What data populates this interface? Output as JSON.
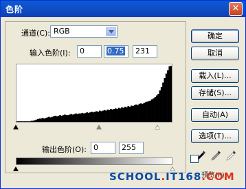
{
  "window": {
    "title": "色阶",
    "close_glyph": "✕"
  },
  "channel": {
    "label": "通道(C):",
    "value": "RGB"
  },
  "input_levels": {
    "label": "输入色阶(I):",
    "black": "0",
    "gamma": "0.75",
    "white": "231"
  },
  "output_levels": {
    "label": "输出色阶(O):",
    "black": "0",
    "white": "255"
  },
  "histogram": {
    "fill": "#000000",
    "values": [
      1,
      1,
      1,
      1,
      1,
      1,
      1,
      1,
      1,
      2,
      2,
      3,
      4,
      5,
      6,
      6,
      7,
      6,
      7,
      8,
      9,
      8,
      9,
      10,
      11,
      10,
      11,
      12,
      11,
      12,
      13,
      12,
      12,
      13,
      14,
      13,
      14,
      15,
      14,
      15,
      15,
      16,
      15,
      16,
      17,
      16,
      17,
      18,
      17,
      18,
      19,
      18,
      20,
      19,
      20,
      21,
      20,
      22,
      21,
      23,
      22,
      23,
      24,
      23,
      25,
      24,
      26,
      25,
      27,
      26,
      28,
      27,
      29,
      28,
      30,
      31,
      30,
      32,
      33,
      32,
      34,
      35,
      36,
      37,
      38,
      40,
      42,
      44,
      47,
      50,
      56,
      62,
      70,
      78,
      86,
      92,
      99,
      100
    ],
    "sliders": {
      "input_black": 0,
      "input_gamma": 0.53,
      "input_white": 0.906,
      "output_black": 0,
      "output_white": 1
    }
  },
  "buttons": {
    "ok": "确定",
    "cancel": "取消",
    "load": "载入(L)...",
    "save": "存储(S)...",
    "auto": "自动(A)",
    "options": "选项(T)..."
  },
  "preview": {
    "label": "预览(P)",
    "checked": false
  },
  "eyedroppers": [
    "black-eyedropper-icon",
    "gray-eyedropper-icon",
    "white-eyedropper-icon"
  ],
  "watermark": {
    "part1": "SCHOOL",
    "dot": ".",
    "part2": "IT168",
    "part3": ".COM"
  }
}
